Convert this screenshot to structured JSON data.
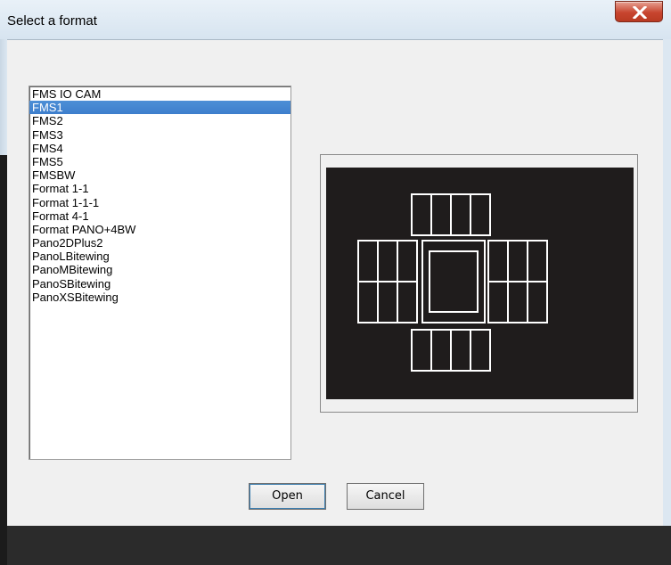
{
  "window": {
    "title": "Select a format"
  },
  "formats": {
    "items": [
      "FMS IO CAM",
      "FMS1",
      "FMS2",
      "FMS3",
      "FMS4",
      "FMS5",
      "FMSBW",
      "Format 1-1",
      "Format 1-1-1",
      "Format 4-1",
      "Format PANO+4BW",
      "Pano2DPlus2",
      "PanoLBitewing",
      "PanoMBitewing",
      "PanoSBitewing",
      "PanoXSBitewing"
    ],
    "selected": "FMS1"
  },
  "buttons": {
    "open": "Open",
    "cancel": "Cancel"
  },
  "colors": {
    "selection": "#3d7ecc",
    "preview_background": "#1f1c1c",
    "preview_lines": "#ffffff"
  }
}
